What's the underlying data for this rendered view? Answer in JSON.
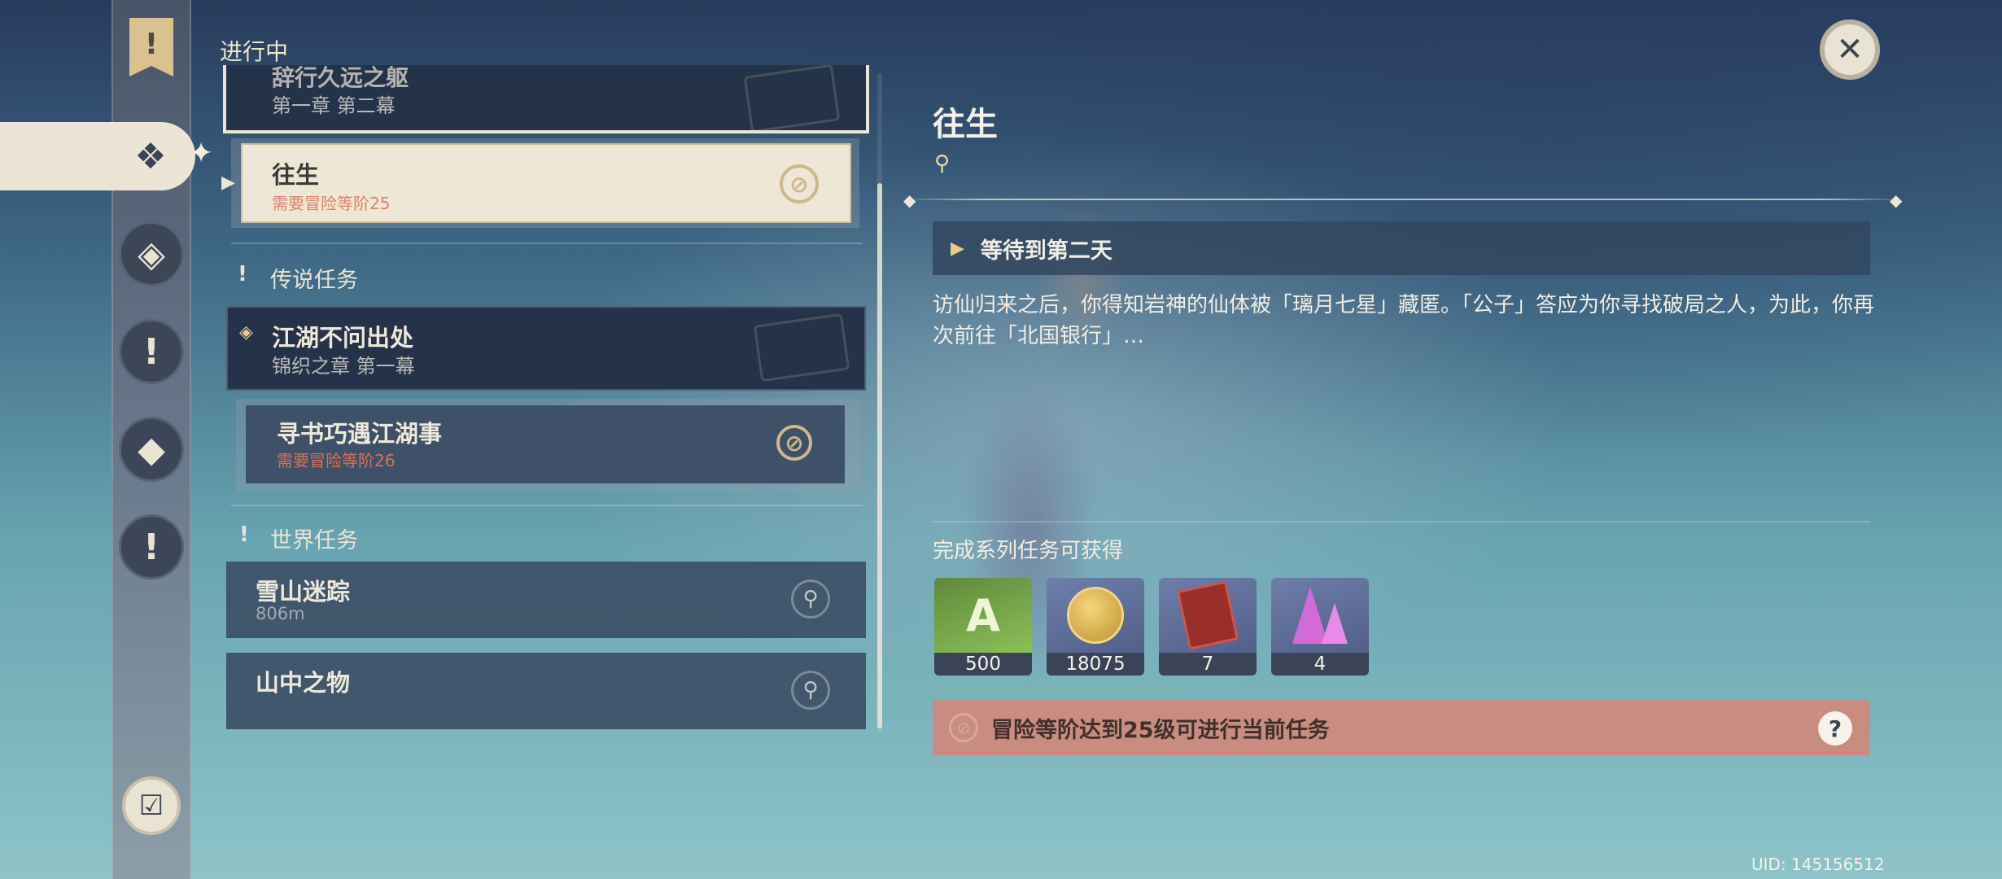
{
  "header": {
    "in_progress": "进行中"
  },
  "left_rail": {
    "top_icon": "quest-banner-icon",
    "active_tab_icon": "archon-quest-icon",
    "tabs": [
      "story-quest-icon",
      "legend-quest-icon",
      "world-quest-icon",
      "commission-quest-icon"
    ],
    "bottom_icon": "quest-checklist-icon"
  },
  "quests": {
    "archon_top": {
      "title": "辞行久远之躯",
      "subtitle": "第一章 第二幕"
    },
    "archon_child": {
      "title": "往生",
      "requirement": "需要冒险等阶25"
    },
    "legend_header": "传说任务",
    "legend_card": {
      "title": "江湖不问出处",
      "subtitle": "锦织之章 第一幕"
    },
    "legend_child": {
      "title": "寻书巧遇江湖事",
      "requirement": "需要冒险等阶26"
    },
    "world_header": "世界任务",
    "world_items": [
      {
        "title": "雪山迷踪",
        "distance": "806m"
      },
      {
        "title": "山中之物",
        "distance": ""
      }
    ]
  },
  "detail": {
    "title": "往生",
    "location_icon": "map-pin-icon",
    "step": "等待到第二天",
    "description": "访仙归来之后，你得知岩神的仙体被「璃月七星」藏匿。「公子」答应为你寻找破局之人，为此，你再次前往「北国银行」…",
    "reward_label": "完成系列任务可获得",
    "rewards": [
      {
        "icon": "adventure-exp-icon",
        "count": "500"
      },
      {
        "icon": "mora-coin-icon",
        "count": "18075"
      },
      {
        "icon": "heros-wit-book-icon",
        "count": "7"
      },
      {
        "icon": "enhancement-crystal-icon",
        "count": "4"
      }
    ],
    "warning": "冒险等阶达到25级可进行当前任务",
    "help": "?"
  },
  "close_label": "✕",
  "uid": "UID: 145156512",
  "colors": {
    "accent": "#e9d9a3",
    "warning_bg": "#c98c80",
    "panel_dark": "#25334a"
  }
}
